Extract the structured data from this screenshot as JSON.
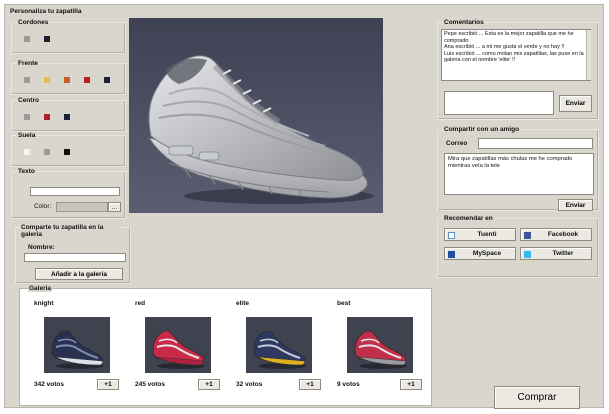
{
  "customize": {
    "title": "Personaliza tu zapatilla",
    "cordones": {
      "label": "Cordones",
      "colors": [
        "#9a9a9a",
        "#1c2030"
      ]
    },
    "frente": {
      "label": "Frente",
      "colors": [
        "#9a9a9a",
        "#e0c24a",
        "#d25a1e",
        "#b51f2c",
        "#1c2030"
      ]
    },
    "centro": {
      "label": "Centro",
      "colors": [
        "#9a9a9a",
        "#b51f2c",
        "#1c2030"
      ]
    },
    "suela": {
      "label": "Suela",
      "colors": [
        "#f2f2f2",
        "#9a9a9a",
        "#111111"
      ]
    },
    "texto": {
      "label": "Texto",
      "value": "",
      "color_label": "Color:",
      "picker_button": "..."
    }
  },
  "share_gallery": {
    "title": "Comparte tu zapatilla en la galeria",
    "name_label": "Nombre:",
    "name_value": "",
    "button": "Añadir a la galeria"
  },
  "comments": {
    "title": "Comentarios",
    "text": "Pepe escribió ... Esta es la mejor zapatilla que me he comprado\nAna escribió ... a mi me gusta el verde y no hay !!\nLuis escribió ... como molan mis zapatillas, las puse en la galeria con el nombre 'elite' !!",
    "input_value": "",
    "button": "Enviar"
  },
  "share_friend": {
    "title": "Compartir con un amigo",
    "email_label": "Correo",
    "email_value": "",
    "message": "Mira que zapatillas más chulas me he comprado mientras veía la tele",
    "button": "Enviar"
  },
  "recommend": {
    "title": "Recomendar en",
    "items": [
      {
        "label": "Tuenti",
        "icon": "tuenti-icon",
        "color": "#5f8dc7"
      },
      {
        "label": "Facebook",
        "icon": "facebook-icon",
        "color": "#3b5998"
      },
      {
        "label": "MySpace",
        "icon": "myspace-icon",
        "color": "#1f4fa3"
      },
      {
        "label": "Twitter",
        "icon": "twitter-icon",
        "color": "#33bbee"
      }
    ]
  },
  "gallery": {
    "title": "Galeria",
    "plus_label": "+1",
    "items": [
      {
        "name": "knight",
        "votes": "342 votos",
        "colors": {
          "body": "#2a3150",
          "accent": "#7f8fb0",
          "sole": "#dde1ea"
        }
      },
      {
        "name": "red",
        "votes": "245 votos",
        "colors": {
          "body": "#c92a48",
          "accent": "#e8e8ea",
          "sole": "#b02040"
        }
      },
      {
        "name": "elite",
        "votes": "32 votos",
        "colors": {
          "body": "#2e3860",
          "accent": "#c8ccd6",
          "sole": "#e0b020"
        }
      },
      {
        "name": "best",
        "votes": "9 votos",
        "colors": {
          "body": "#c0304a",
          "accent": "#e6e6e8",
          "sole": "#9c9ca0"
        }
      }
    ]
  },
  "buy_button": "Comprar"
}
